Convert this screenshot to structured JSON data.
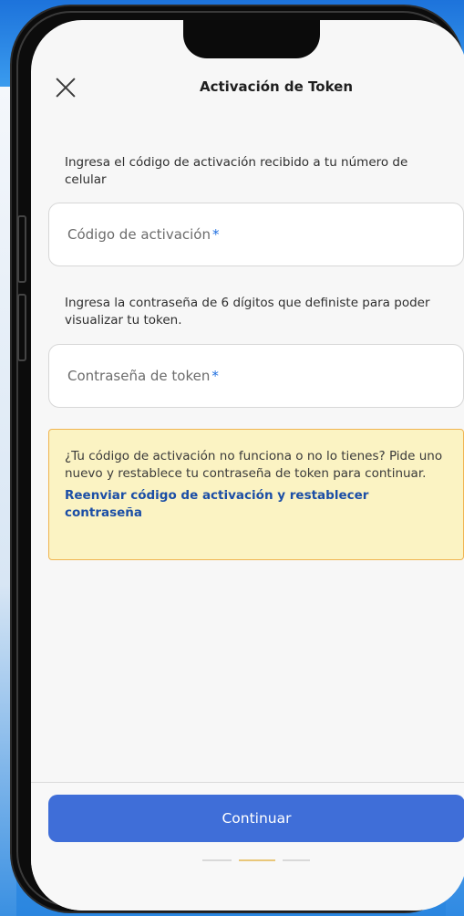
{
  "header": {
    "title": "Activación de Token",
    "close_icon": "close-icon"
  },
  "form": {
    "activation_instruction": "Ingresa el código de activación recibido a tu número de celular",
    "activation_code_label": "Código de activación",
    "activation_code_required_mark": "*",
    "password_instruction": "Ingresa la contraseña de 6 dígitos que definiste para poder visualizar tu token.",
    "token_password_label": "Contraseña de token",
    "token_password_required_mark": "*"
  },
  "notice": {
    "text": "¿Tu código de activación no funciona o no lo tienes? Pide uno nuevo y restablece tu contraseña de token para continuar.",
    "link": "Reenviar código de activación y restablecer contraseña"
  },
  "footer": {
    "continue_label": "Continuar"
  },
  "colors": {
    "primary_button": "#3f6ed8",
    "link": "#1b4ea6",
    "required_mark": "#1f6fe0",
    "notice_background": "#fbf3c3",
    "notice_border": "#f0b450"
  }
}
